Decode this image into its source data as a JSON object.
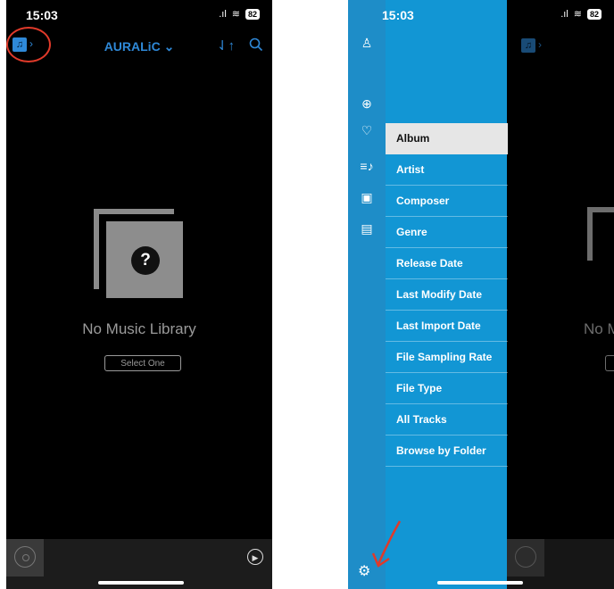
{
  "left_screen": {
    "status": {
      "time": "15:03",
      "battery": "82"
    },
    "nav": {
      "device_title": "AURALiC",
      "device_chevron": "⌄"
    },
    "empty": {
      "message": "No Music Library",
      "select_button": "Select One"
    }
  },
  "right_screen": {
    "status": {
      "time": "15:03",
      "battery": "82"
    },
    "menu": {
      "items": [
        {
          "label": "Album",
          "active": true
        },
        {
          "label": "Artist"
        },
        {
          "label": "Composer"
        },
        {
          "label": "Genre"
        },
        {
          "label": "Release Date"
        },
        {
          "label": "Last Modify Date"
        },
        {
          "label": "Last Import Date"
        },
        {
          "label": "File Sampling Rate"
        },
        {
          "label": "File Type"
        },
        {
          "label": "All Tracks"
        },
        {
          "label": "Browse by Folder"
        }
      ]
    },
    "behind": {
      "text_fragment": "No M"
    }
  },
  "colors": {
    "accent": "#2f89d8",
    "drawer": "#1296d4",
    "rail": "#1e8dc8",
    "highlight": "#e03a2a"
  },
  "icons": [
    "music-library-icon",
    "sort-icon",
    "search-icon",
    "user-icon",
    "login-icon",
    "heart-icon",
    "playlist-icon",
    "library-icon",
    "radio-icon",
    "gear-icon",
    "play-icon",
    "disc-icon"
  ]
}
